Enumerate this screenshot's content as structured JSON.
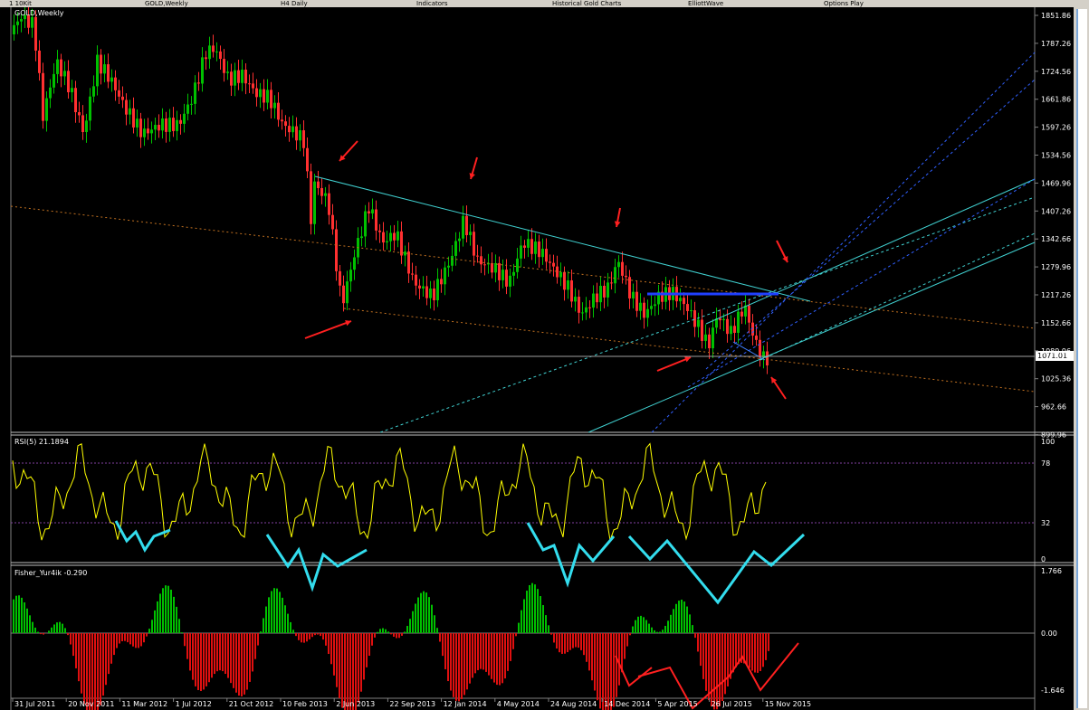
{
  "window": {
    "tabs": [
      "1 10Kit",
      "GOLD,Weekly",
      "H4 Daily",
      "Indicators",
      "Historical Gold Charts",
      "ElliottWave",
      "Options Play"
    ]
  },
  "main_chart": {
    "title": "GOLD,Weekly",
    "price_labels": [
      "1851.86",
      "1787.26",
      "1724.56",
      "1661.86",
      "1597.26",
      "1534.56",
      "1469.96",
      "1407.26",
      "1342.66",
      "1279.96",
      "1217.26",
      "1152.66",
      "1089.96",
      "1025.36",
      "962.66",
      "899.96"
    ],
    "current_price": "1071.01"
  },
  "rsi_panel": {
    "title": "RSI(5) 21.1894",
    "levels": [
      "100",
      "78",
      "32",
      "0"
    ]
  },
  "fisher_panel": {
    "title": "Fisher_Yur4ik -0.290",
    "levels": [
      "1.766",
      "0.00",
      "-1.646"
    ]
  },
  "time_axis": {
    "labels": [
      "31 Jul 2011",
      "20 Nov 2011",
      "11 Mar 2012",
      "1 Jul 2012",
      "21 Oct 2012",
      "10 Feb 2013",
      "2 Jun 2013",
      "22 Sep 2013",
      "12 Jan 2014",
      "4 May 2014",
      "24 Aug 2014",
      "14 Dec 2014",
      "5 Apr 2015",
      "26 Jul 2015",
      "15 Nov 2015"
    ]
  },
  "colors": {
    "bull": "#00c000",
    "bear": "#ff3030",
    "rsi": "#ffff00",
    "annot_arrow": "#ff2020",
    "annot_cyan": "#33ddee",
    "trendline": "#40d0d0",
    "orange_dotted": "#c07020",
    "blue_dashed": "#3060ff"
  }
}
